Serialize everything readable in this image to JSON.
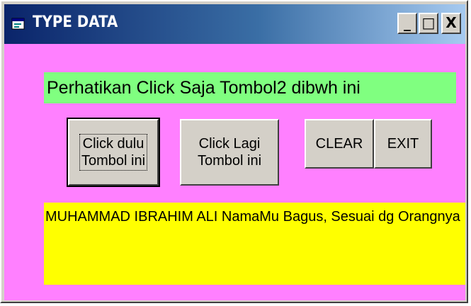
{
  "window": {
    "title": "TYPE DATA",
    "minimize_glyph": "_",
    "maximize_glyph": "□",
    "close_glyph": "X"
  },
  "form": {
    "heading": "Perhatikan Click Saja Tombol2 dibwh ini",
    "button1": {
      "line1": "Click dulu",
      "line2": "Tombol ini"
    },
    "button2": {
      "line1": "Click Lagi",
      "line2": "Tombol ini"
    },
    "clear_label": "CLEAR",
    "exit_label": "EXIT",
    "output_text": "MUHAMMAD IBRAHIM  ALI   NamaMu Bagus, Sesuai dg Orangnya"
  },
  "colors": {
    "form_background": "#ff80ff",
    "heading_background": "#80ff80",
    "output_background": "#ffff00",
    "titlebar_start": "#0a246a",
    "titlebar_end": "#a6caf0"
  },
  "icons": {
    "app": "app-form-icon",
    "minimize": "minimize-icon",
    "maximize": "maximize-icon",
    "close": "close-icon"
  }
}
